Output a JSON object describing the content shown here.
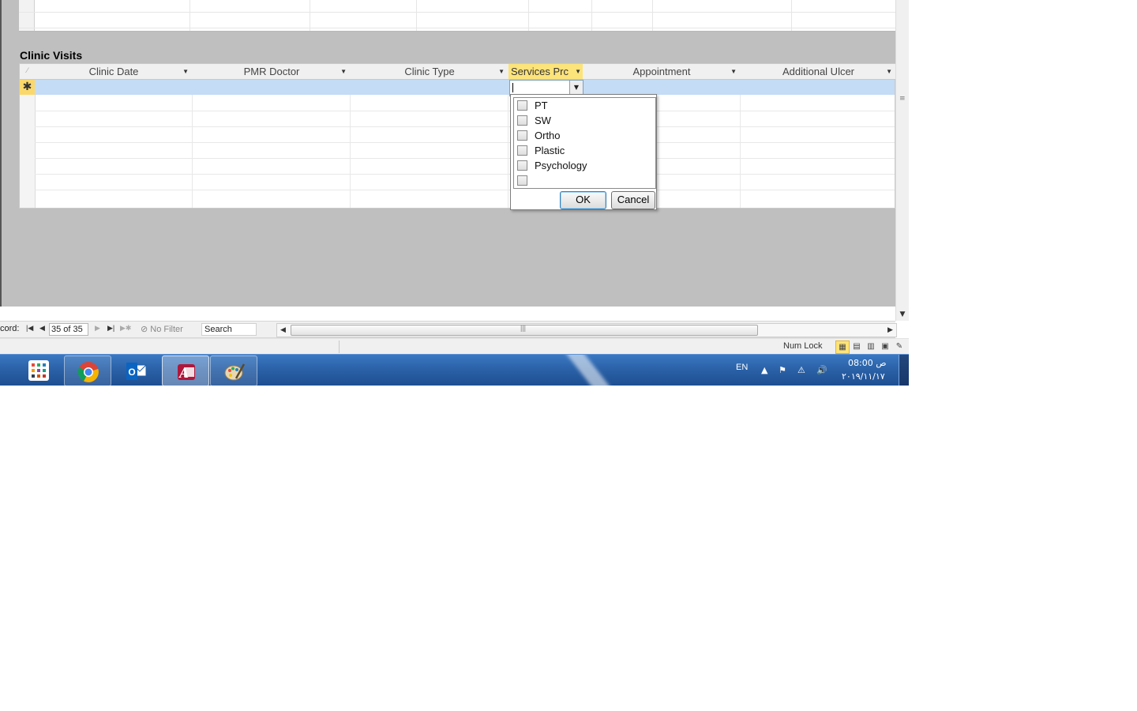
{
  "section_title": "Clinic Visits",
  "columns": [
    {
      "label": "Clinic Date"
    },
    {
      "label": "PMR Doctor"
    },
    {
      "label": "Clinic Type"
    },
    {
      "label": "Services Prc"
    },
    {
      "label": "Appointment"
    },
    {
      "label": "Additional Ulcer"
    }
  ],
  "new_row_marker": "✱",
  "popup": {
    "options": [
      "PT",
      "SW",
      "Ortho",
      "Plastic",
      "Psychology",
      ""
    ],
    "ok_label": "OK",
    "cancel_label": "Cancel"
  },
  "navbar": {
    "record_label": "cord:",
    "record_value": "35 of 35",
    "filter_label": "No Filter",
    "search_label": "Search"
  },
  "statusbar": {
    "numlock": "Num Lock"
  },
  "taskbar": {
    "apps": [
      "start-grid",
      "chrome",
      "outlook",
      "access",
      "paint"
    ],
    "language": "EN",
    "time": "08:00 ص",
    "date": "٢٠١٩/١١/١٧"
  },
  "colors": {
    "active_header": "#fce37a",
    "new_row": "#c4dcf5",
    "taskbar": "#2b62a8"
  }
}
